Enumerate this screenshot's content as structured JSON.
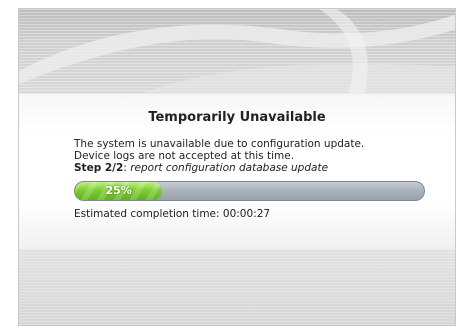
{
  "dialog": {
    "title": "Temporarily Unavailable",
    "message_line1": "The system is unavailable due to configuration update.",
    "message_line2": "Device logs are not accepted at this time.",
    "step_label": "Step 2/2",
    "step_separator": ": ",
    "step_description": "report configuration database update",
    "progress": {
      "percent": 25,
      "label": "25%"
    },
    "eta_label": "Estimated completion time: ",
    "eta_value": "00:00:27"
  },
  "colors": {
    "progress_fill": "#6cc227",
    "progress_track": "#a9b1b9",
    "title_text": "#222222"
  }
}
